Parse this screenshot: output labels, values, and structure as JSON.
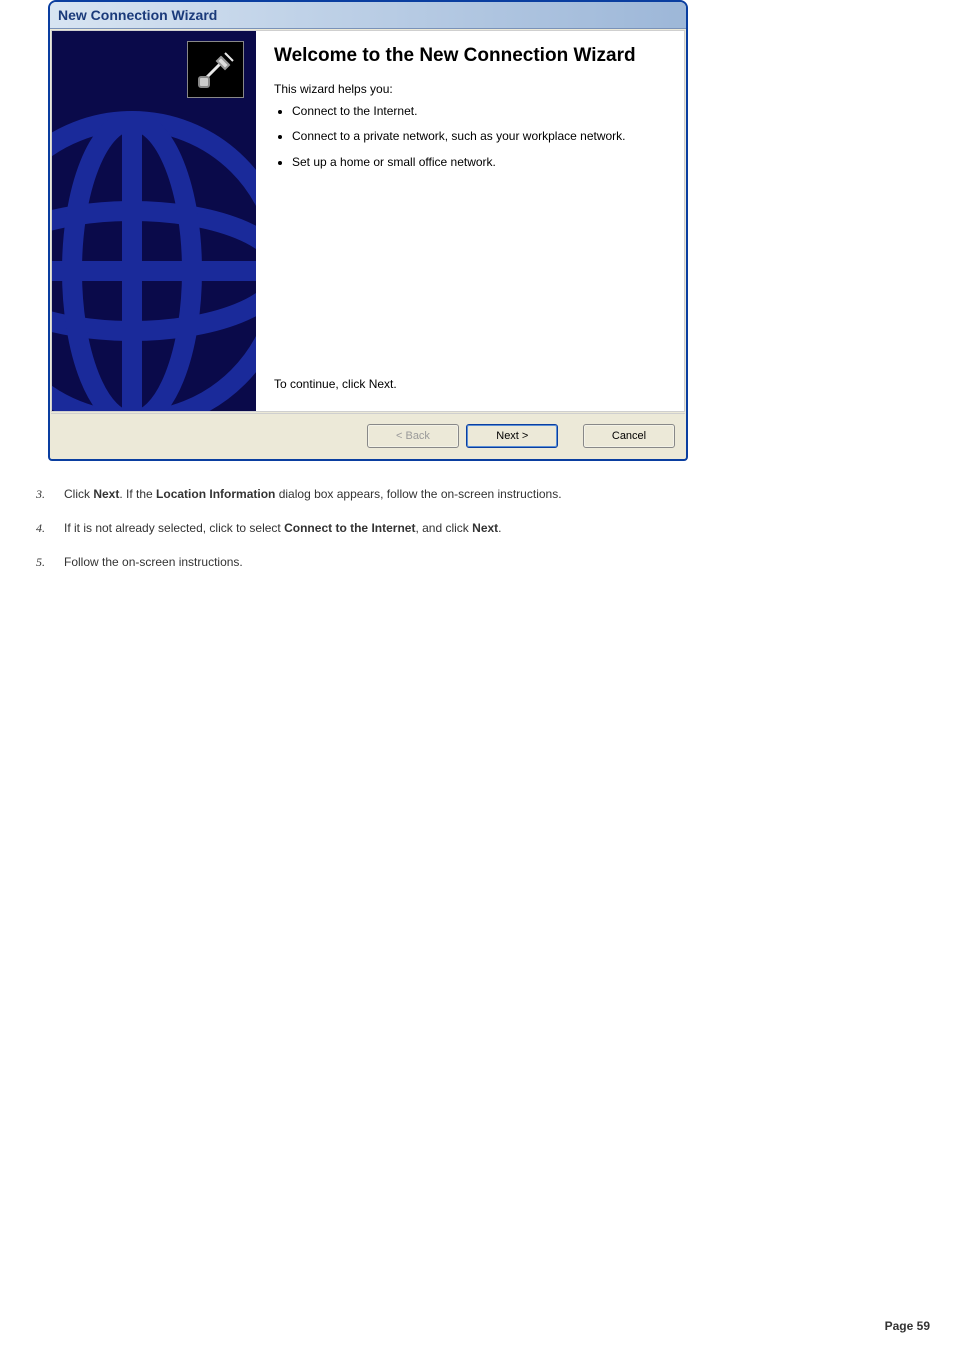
{
  "dialog": {
    "title": "New Connection Wizard",
    "heading": "Welcome to the New Connection Wizard",
    "intro": "This wizard helps you:",
    "bullets": [
      "Connect to the Internet.",
      "Connect to a private network, such as your workplace network.",
      "Set up a home or small office network."
    ],
    "continue": "To continue, click Next.",
    "buttons": {
      "back": "< Back",
      "next": "Next >",
      "cancel": "Cancel"
    }
  },
  "steps": {
    "s3a": "Click ",
    "s3b": "Next",
    "s3c": ". If the ",
    "s3d": "Location Information",
    "s3e": " dialog box appears, follow the on-screen instructions.",
    "s4a": "If it is not already selected, click to select ",
    "s4b": "Connect to the Internet",
    "s4c": ", and click ",
    "s4d": "Next",
    "s4e": ".",
    "s5": "Follow the on-screen instructions."
  },
  "pageNumber": "Page 59"
}
